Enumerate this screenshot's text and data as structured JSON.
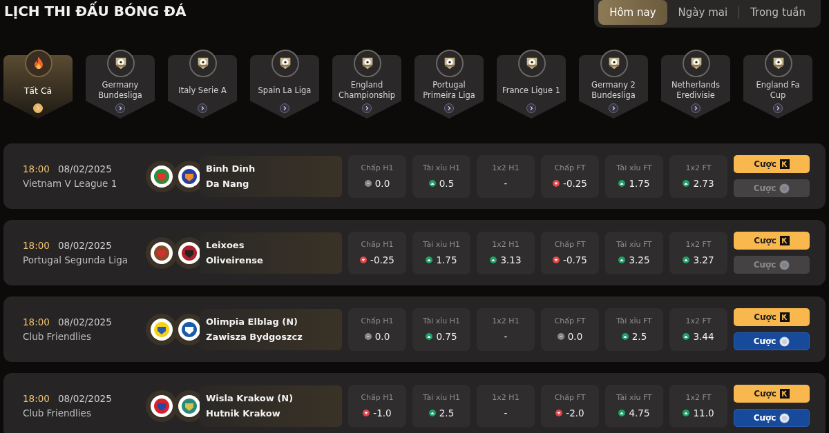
{
  "title": "LỊCH THI ĐẤU BÓNG ĐÁ",
  "date_tabs": [
    {
      "label": "Hôm nay",
      "selected": true
    },
    {
      "label": "Ngày mai",
      "selected": false
    },
    {
      "label": "Trong tuần",
      "selected": false
    }
  ],
  "leagues": [
    {
      "name": "Tất Cả",
      "kind": "all",
      "selected": true
    },
    {
      "name": "Germany Bundesliga",
      "kind": "league",
      "selected": false
    },
    {
      "name": "Italy Serie A",
      "kind": "league",
      "selected": false
    },
    {
      "name": "Spain La Liga",
      "kind": "league",
      "selected": false
    },
    {
      "name": "England Championship",
      "kind": "league",
      "selected": false
    },
    {
      "name": "Portugal Primeira Liga",
      "kind": "league",
      "selected": false
    },
    {
      "name": "France Ligue 1",
      "kind": "league",
      "selected": false
    },
    {
      "name": "Germany 2 Bundesliga",
      "kind": "league",
      "selected": false
    },
    {
      "name": "Netherlands Eredivisie",
      "kind": "league",
      "selected": false
    },
    {
      "name": "England Fa Cup",
      "kind": "league",
      "selected": false
    }
  ],
  "matches": [
    {
      "time": "18:00",
      "date": "08/02/2025",
      "league": "Vietnam V League 1",
      "home": "Binh Dinh",
      "away": "Da Nang",
      "odds": [
        {
          "label": "Chấp H1",
          "value": "0.0",
          "kind": "flat"
        },
        {
          "label": "Tài xỉu H1",
          "value": "0.5",
          "kind": "up"
        },
        {
          "label": "1x2 H1",
          "value": "-",
          "kind": "plain"
        },
        {
          "label": "Chấp FT",
          "value": "-0.25",
          "kind": "down"
        },
        {
          "label": "Tài xỉu FT",
          "value": "1.75",
          "kind": "up"
        },
        {
          "label": "1x2 FT",
          "value": "2.73",
          "kind": "up"
        }
      ],
      "bet_buttons": [
        {
          "label": "Cược",
          "kind": "k",
          "disabled": false
        },
        {
          "label": "Cược",
          "kind": "coin",
          "disabled": true
        }
      ]
    },
    {
      "time": "18:00",
      "date": "08/02/2025",
      "league": "Portugal Segunda Liga",
      "home": "Leixoes",
      "away": "Oliveirense",
      "odds": [
        {
          "label": "Chấp H1",
          "value": "-0.25",
          "kind": "down"
        },
        {
          "label": "Tài xỉu H1",
          "value": "1.75",
          "kind": "up"
        },
        {
          "label": "1x2 H1",
          "value": "3.13",
          "kind": "up"
        },
        {
          "label": "Chấp FT",
          "value": "-0.75",
          "kind": "down"
        },
        {
          "label": "Tài xỉu FT",
          "value": "3.25",
          "kind": "up"
        },
        {
          "label": "1x2 FT",
          "value": "3.27",
          "kind": "up"
        }
      ],
      "bet_buttons": [
        {
          "label": "Cược",
          "kind": "k",
          "disabled": false
        },
        {
          "label": "Cược",
          "kind": "coin",
          "disabled": true
        }
      ]
    },
    {
      "time": "18:00",
      "date": "08/02/2025",
      "league": "Club Friendlies",
      "home": "Olimpia Elblag (N)",
      "away": "Zawisza Bydgoszcz",
      "odds": [
        {
          "label": "Chấp H1",
          "value": "0.0",
          "kind": "flat"
        },
        {
          "label": "Tài xỉu H1",
          "value": "0.75",
          "kind": "up"
        },
        {
          "label": "1x2 H1",
          "value": "-",
          "kind": "plain"
        },
        {
          "label": "Chấp FT",
          "value": "0.0",
          "kind": "flat"
        },
        {
          "label": "Tài xỉu FT",
          "value": "2.5",
          "kind": "up"
        },
        {
          "label": "1x2 FT",
          "value": "3.44",
          "kind": "up"
        }
      ],
      "bet_buttons": [
        {
          "label": "Cược",
          "kind": "k",
          "disabled": false
        },
        {
          "label": "Cược",
          "kind": "coin",
          "disabled": false
        }
      ]
    },
    {
      "time": "18:00",
      "date": "08/02/2025",
      "league": "Club Friendlies",
      "home": "Wisla Krakow (N)",
      "away": "Hutnik Krakow",
      "odds": [
        {
          "label": "Chấp H1",
          "value": "-1.0",
          "kind": "down"
        },
        {
          "label": "Tài xỉu H1",
          "value": "2.5",
          "kind": "up"
        },
        {
          "label": "1x2 H1",
          "value": "-",
          "kind": "plain"
        },
        {
          "label": "Chấp FT",
          "value": "-2.0",
          "kind": "down"
        },
        {
          "label": "Tài xỉu FT",
          "value": "4.75",
          "kind": "up"
        },
        {
          "label": "1x2 FT",
          "value": "11.0",
          "kind": "up"
        }
      ],
      "bet_buttons": [
        {
          "label": "Cược",
          "kind": "k",
          "disabled": false
        },
        {
          "label": "Cược",
          "kind": "coin",
          "disabled": false
        }
      ]
    }
  ]
}
